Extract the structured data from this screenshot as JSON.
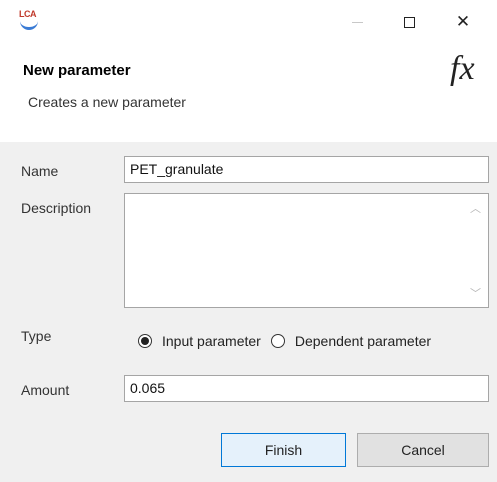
{
  "window": {
    "logo_text": "LCA",
    "minimize_icon": "minimize-icon",
    "maximize_icon": "maximize-icon",
    "close_icon": "close-icon",
    "close_glyph": "✕"
  },
  "header": {
    "title": "New parameter",
    "subtitle": "Creates a new parameter",
    "icon_glyph": "fx"
  },
  "form": {
    "name_label": "Name",
    "name_value": "PET_granulate",
    "description_label": "Description",
    "description_value": "",
    "type_label": "Type",
    "type_options": [
      {
        "label": "Input parameter",
        "selected": true
      },
      {
        "label": "Dependent parameter",
        "selected": false
      }
    ],
    "amount_label": "Amount",
    "amount_value": "0.065"
  },
  "buttons": {
    "finish": "Finish",
    "cancel": "Cancel"
  },
  "colors": {
    "accent": "#0078d7",
    "form_bg": "#f0f0f0"
  }
}
